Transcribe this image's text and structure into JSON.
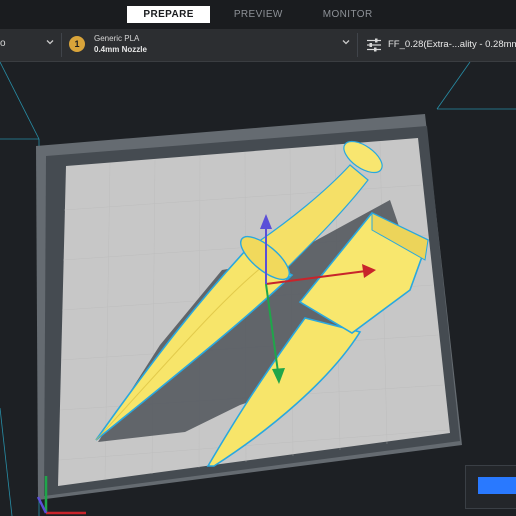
{
  "tabs": [
    {
      "label": "PREPARE",
      "active": true
    },
    {
      "label": "PREVIEW",
      "active": false
    },
    {
      "label": "MONITOR",
      "active": false
    }
  ],
  "toolbar": {
    "printer_fragment": "o",
    "material": {
      "badge": "1",
      "name": "Generic PLA",
      "nozzle": "0.4mm Nozzle",
      "color": "#d9a43a"
    },
    "profile": {
      "label": "FF_0.28(Extra-...ality - 0.28mm"
    }
  },
  "scene": {
    "model_color": "#f7e56a",
    "outline_color": "#29a8df",
    "axes": [
      {
        "name": "x",
        "color": "#c8242b"
      },
      {
        "name": "y",
        "color": "#1fa64a"
      },
      {
        "name": "z",
        "color": "#5b4fd8"
      }
    ]
  },
  "colors": {
    "accent": "#2979ff",
    "background": "#1d2024",
    "bed": "#c7c7c7"
  }
}
